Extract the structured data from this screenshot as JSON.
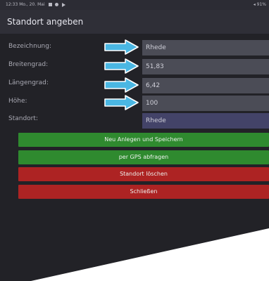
{
  "status_bar": {
    "left": "12:33  Mo., 20. Mai",
    "right": "91%"
  },
  "header": {
    "title": "Standort angeben"
  },
  "form": {
    "rows": [
      {
        "label": "Bezeichnung:",
        "value": "Rhede"
      },
      {
        "label": "Breitengrad:",
        "value": "51,83"
      },
      {
        "label": "Längengrad:",
        "value": "6,42"
      },
      {
        "label": "Höhe:",
        "value": "100"
      },
      {
        "label": "Standort:",
        "value": "Rhede"
      }
    ]
  },
  "buttons": {
    "save": "Neu Anlegen und Speichern",
    "gps": "per GPS abfragen",
    "delete": "Standort löschen",
    "close": "Schließen"
  },
  "colors": {
    "arrow_fill": "#4ab7e3",
    "button_green": "#2f8a2f",
    "button_red": "#ad2323",
    "background": "#222227"
  }
}
